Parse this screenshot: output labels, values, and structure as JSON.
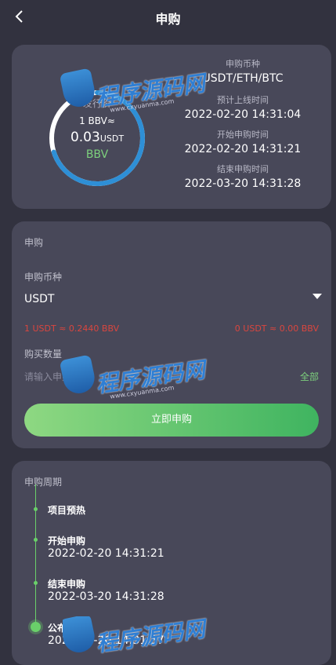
{
  "header": {
    "title": "申购"
  },
  "summary": {
    "ring_label": "发行价",
    "rate_line": "1 BBV≈",
    "price_value": "0.03",
    "price_unit": "USDT",
    "coin": "BBV",
    "progress_fraction": 0.7,
    "items": [
      {
        "label": "申购币种",
        "value": "USDT/ETH/BTC"
      },
      {
        "label": "预计上线时间",
        "value": "2022-02-20 14:31:04"
      },
      {
        "label": "开始申购时间",
        "value": "2022-02-20 14:31:21"
      },
      {
        "label": "结束申购时间",
        "value": "2022-03-20 14:31:28"
      }
    ]
  },
  "purchase": {
    "title": "申购",
    "currency_label": "申购币种",
    "currency_value": "USDT",
    "rate_left": "1 USDT ≈ 0.2440 BBV",
    "rate_right": "0 USDT ≈ 0.00 BBV",
    "amount_label": "购买数量",
    "amount_placeholder": "请输入申购数量",
    "all_label": "全部",
    "submit_label": "立即申购"
  },
  "period": {
    "title": "申购周期",
    "steps": [
      {
        "name": "项目预热",
        "time": ""
      },
      {
        "name": "开始申购",
        "time": "2022-02-20 14:31:21"
      },
      {
        "name": "结束申购",
        "time": "2022-03-20 14:31:28"
      },
      {
        "name": "公布结果",
        "time": "2022-03-20 14:31:37"
      }
    ]
  },
  "watermark": {
    "text": "程序源码网",
    "url": "www.cxyuanma.com"
  },
  "colors": {
    "background": "#32323f",
    "card": "#484859",
    "accent_green": "#6ad06a",
    "ring_blue": "#2e8fd6",
    "warning_red": "#d9463f"
  }
}
